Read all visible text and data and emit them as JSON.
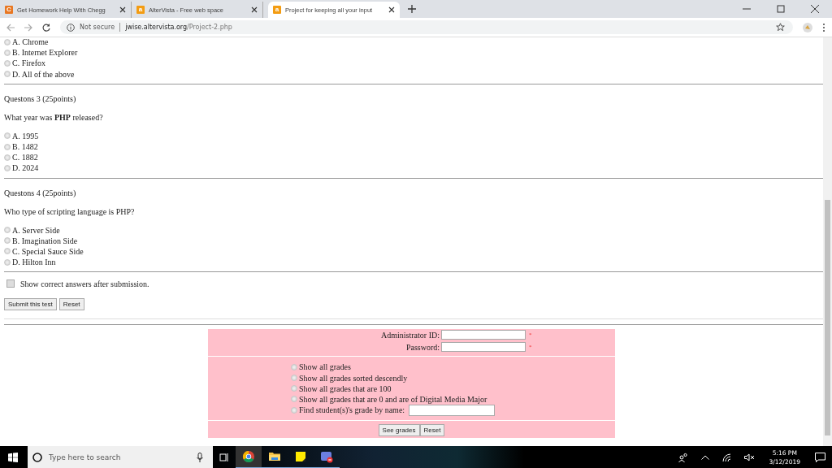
{
  "browser": {
    "tabs": [
      {
        "title": "Get Homework Help With Chegg",
        "icon_letter": "C",
        "kind": "chegg",
        "selected": false
      },
      {
        "title": "AlterVista - Free web space",
        "icon_letter": "a",
        "kind": "altervista",
        "selected": false
      },
      {
        "title": "Project for keeping all your input",
        "icon_letter": "a",
        "kind": "altervista",
        "selected": true
      }
    ],
    "security": "Not secure",
    "url_host": "jwise.altervista.org",
    "url_path": "/Project-2.php"
  },
  "previous_options": [
    {
      "label": "A. Chrome",
      "selected": false
    },
    {
      "label": "B. Internet Explorer",
      "selected": false
    },
    {
      "label": "C. Firefox",
      "selected": false
    },
    {
      "label": "D. All of the above",
      "selected": false
    }
  ],
  "questions": [
    {
      "heading": "Questons 3 (25points)",
      "prompt": "What year was **PHP** released?",
      "options": [
        {
          "label": "A. 1995",
          "selected": false
        },
        {
          "label": "B. 1482",
          "selected": false
        },
        {
          "label": "C. 1882",
          "selected": false
        },
        {
          "label": "D. 2024",
          "selected": false
        }
      ]
    },
    {
      "heading": "Questons 4 (25points)",
      "prompt": "Who type of scripting language is PHP?",
      "options": [
        {
          "label": "A. Server Side",
          "selected": false
        },
        {
          "label": "B. Imagination Side",
          "selected": false
        },
        {
          "label": "C. Special Sauce Side",
          "selected": false
        },
        {
          "label": "D. Hilton Inn",
          "selected": false
        }
      ]
    }
  ],
  "show_answers": {
    "label": "Show correct answers after submission.",
    "checked": false
  },
  "test_buttons": [
    "Submit this test",
    "Reset"
  ],
  "admin": {
    "fields": [
      {
        "label": "Administrator ID:",
        "required": true,
        "required_mark": "*"
      },
      {
        "label": "Password:",
        "required": true,
        "required_mark": "*"
      }
    ],
    "options": [
      {
        "label": "Show all grades",
        "kind": "plain",
        "selected": false
      },
      {
        "label": "Show all grades sorted descendly",
        "kind": "plain",
        "selected": false
      },
      {
        "label": "Show all grades that are 100",
        "kind": "plain",
        "selected": false
      },
      {
        "label": "Show all grades that are 0 and are of Digital Media Major",
        "kind": "plain",
        "selected": false
      },
      {
        "label": "Find student(s)'s grade by name:",
        "kind": "text_input",
        "selected": false
      }
    ],
    "buttons": [
      "See grades",
      "Reset"
    ]
  },
  "taskbar": {
    "search_placeholder": "Type here to search",
    "time": "5:16 PM",
    "date": "3/12/2019"
  }
}
